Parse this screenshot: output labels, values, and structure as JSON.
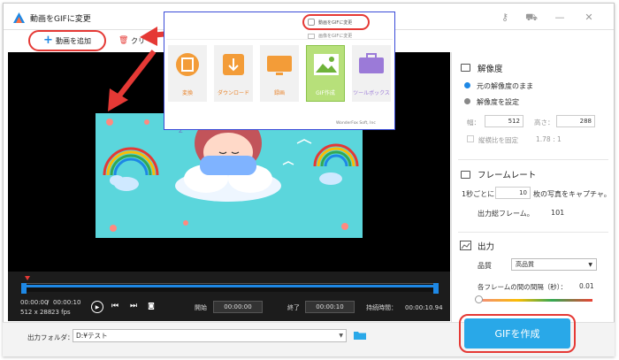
{
  "window": {
    "title": "動画をGIFに変更"
  },
  "toolbar": {
    "add_label": "動画を追加",
    "delete_label": "クリ"
  },
  "popup": {
    "menu_item_1": "動画をGIFに変更",
    "menu_item_2": "画像をGIFに変更",
    "tiles": [
      {
        "label": "変換"
      },
      {
        "label": "ダウンロード"
      },
      {
        "label": "録画"
      },
      {
        "label": "GIF作成"
      },
      {
        "label": "ツールボックス"
      }
    ],
    "footer": "WonderFox Soft, Inc"
  },
  "timeline": {
    "current_time": "00:00:00",
    "total_time": "00:00:10",
    "resolution": "512 x 288",
    "fps": "23 fps",
    "start_label": "開始",
    "start_value": "00:00:00",
    "end_label": "終了",
    "end_value": "00:00:10",
    "duration_label": "持続時間：",
    "duration_value": "00:00:10.94"
  },
  "panel": {
    "resolution_title": "解像度",
    "keep_original": "元の解像度のまま",
    "set_resolution": "解像度を設定",
    "width_label": "幅：",
    "width_value": "512",
    "height_label": "高さ：",
    "height_value": "288",
    "aspect_label": "縦横比を固定",
    "aspect_value": "1.78 : 1",
    "framerate_title": "フレームレート",
    "per_second_prefix": "1秒ごとに",
    "per_second_value": "10",
    "per_second_suffix": "枚の写真をキャプチャ。",
    "total_frames_label": "出力総フレーム。",
    "total_frames_value": "101",
    "output_title": "出力",
    "quality_label": "品質",
    "quality_value": "高品質",
    "interval_label": "各フレームの間の間隔（秒）：",
    "interval_value": "0.01"
  },
  "bottom": {
    "output_folder_label": "出力フォルダ：",
    "output_folder_value": "D:¥テスト",
    "create_label": "GIFを作成"
  },
  "colors": {
    "accent_blue": "#29a8e8",
    "highlight_red": "#e53935",
    "popup_border": "#3a4bd8",
    "scene_bg": "#5bd6dc"
  }
}
